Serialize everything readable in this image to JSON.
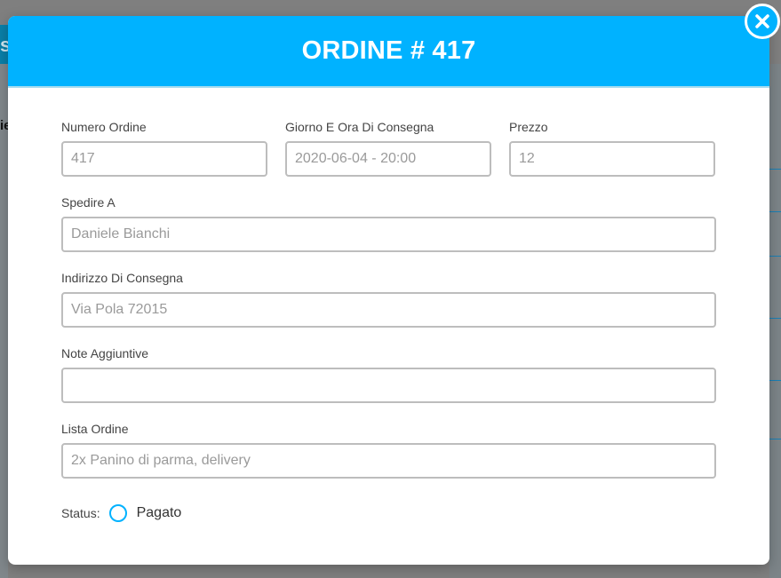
{
  "background": {
    "tab_glyph": "s",
    "header_fragment": "ie"
  },
  "modal": {
    "title": "ORDINE # 417",
    "close_icon": "close-circle-icon"
  },
  "form": {
    "order_number": {
      "label": "Numero Ordine",
      "placeholder": "417"
    },
    "delivery_datetime": {
      "label": "Giorno E Ora Di Consegna",
      "placeholder": "2020-06-04 - 20:00"
    },
    "price": {
      "label": "Prezzo",
      "placeholder": "12"
    },
    "ship_to": {
      "label": "Spedire A",
      "placeholder": "Daniele Bianchi"
    },
    "delivery_address": {
      "label": "Indirizzo Di Consegna",
      "placeholder": "Via Pola 72015"
    },
    "notes": {
      "label": "Note Aggiuntive",
      "placeholder": ""
    },
    "order_list": {
      "label": "Lista Ordine",
      "placeholder": "2x Panino di parma, delivery"
    },
    "status": {
      "label": "Status:",
      "option_label": "Pagato",
      "checked": false
    }
  },
  "colors": {
    "accent": "#00b2ff",
    "overlay": "#7f7f7f",
    "input_border": "#bdbdbd"
  }
}
